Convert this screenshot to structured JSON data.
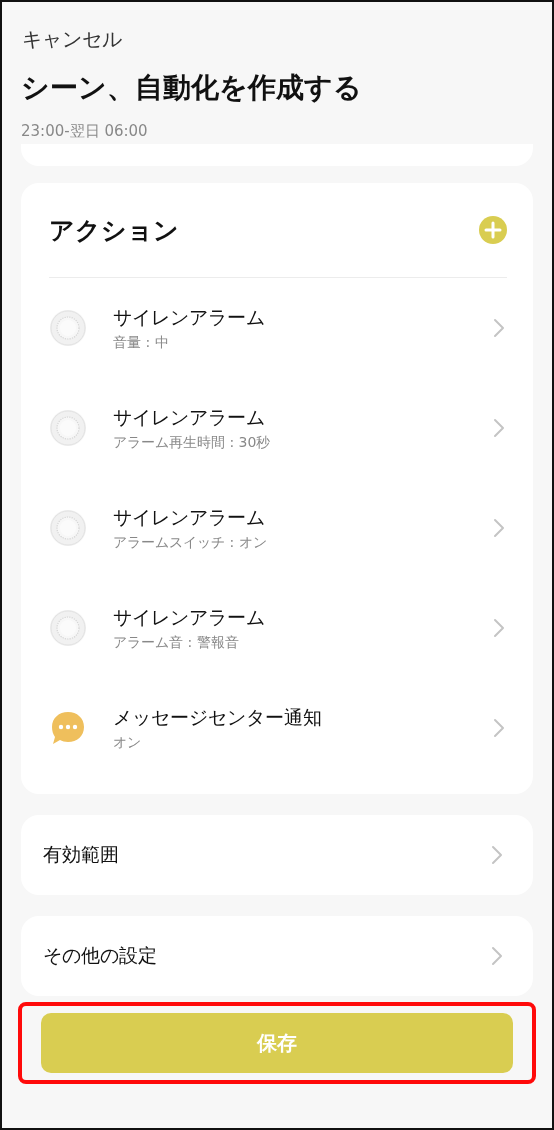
{
  "header": {
    "cancel": "キャンセル",
    "title": "シーン、自動化を作成する",
    "subtitle": "23:00-翌日 06:00"
  },
  "actions": {
    "title": "アクション",
    "items": [
      {
        "kind": "siren",
        "name": "サイレンアラーム",
        "detail": "音量 : 中"
      },
      {
        "kind": "siren",
        "name": "サイレンアラーム",
        "detail": "アラーム再生時間 : 30秒"
      },
      {
        "kind": "siren",
        "name": "サイレンアラーム",
        "detail": "アラームスイッチ : オン"
      },
      {
        "kind": "siren",
        "name": "サイレンアラーム",
        "detail": "アラーム音 : 警報音"
      },
      {
        "kind": "message",
        "name": "メッセージセンター通知",
        "detail": "オン"
      }
    ]
  },
  "settings": [
    {
      "label": "有効範囲"
    },
    {
      "label": "その他の設定"
    }
  ],
  "save_button": {
    "label": "保存",
    "highlighted": true
  }
}
